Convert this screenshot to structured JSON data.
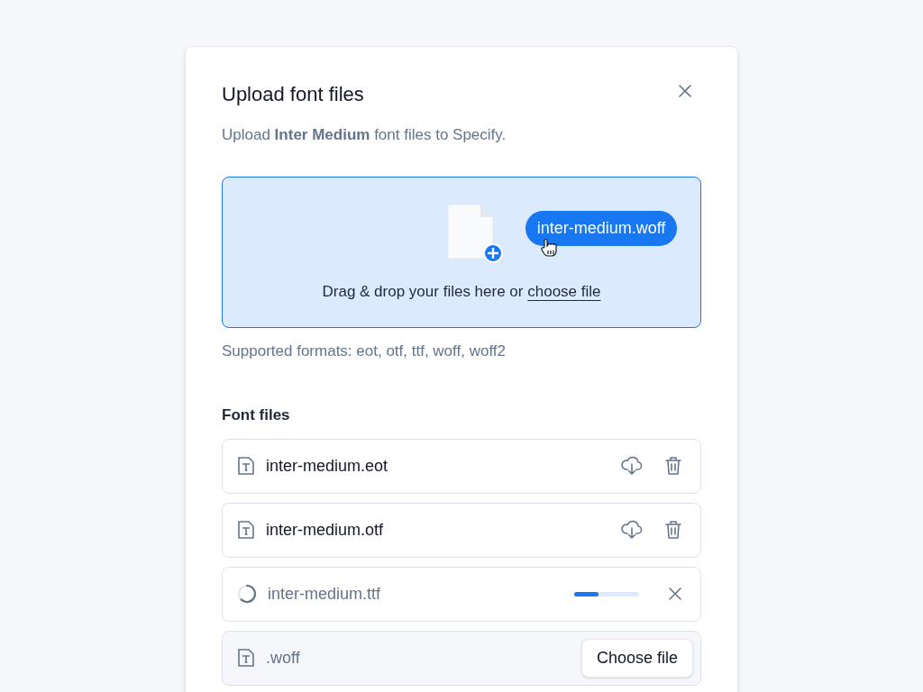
{
  "dialog": {
    "title": "Upload font files",
    "subtitle": "Upload **Inter Medium** font files to Specify."
  },
  "dropzone": {
    "dragged_file": "inter-medium.woff",
    "prompt": "Drag & drop your files here or",
    "link": "choose file",
    "hint": "Supported formats: eot, otf, ttf, woff, woff2"
  },
  "font_files": {
    "heading": "Font files",
    "rows": [
      {
        "kind": "uploaded",
        "name": "inter-medium.eot"
      },
      {
        "kind": "uploaded",
        "name": "inter-medium.otf"
      },
      {
        "kind": "uploading",
        "name": "inter-medium.ttf",
        "level": 0.38
      },
      {
        "kind": "missing",
        "name": ".woff",
        "button": "Choose file"
      }
    ]
  }
}
